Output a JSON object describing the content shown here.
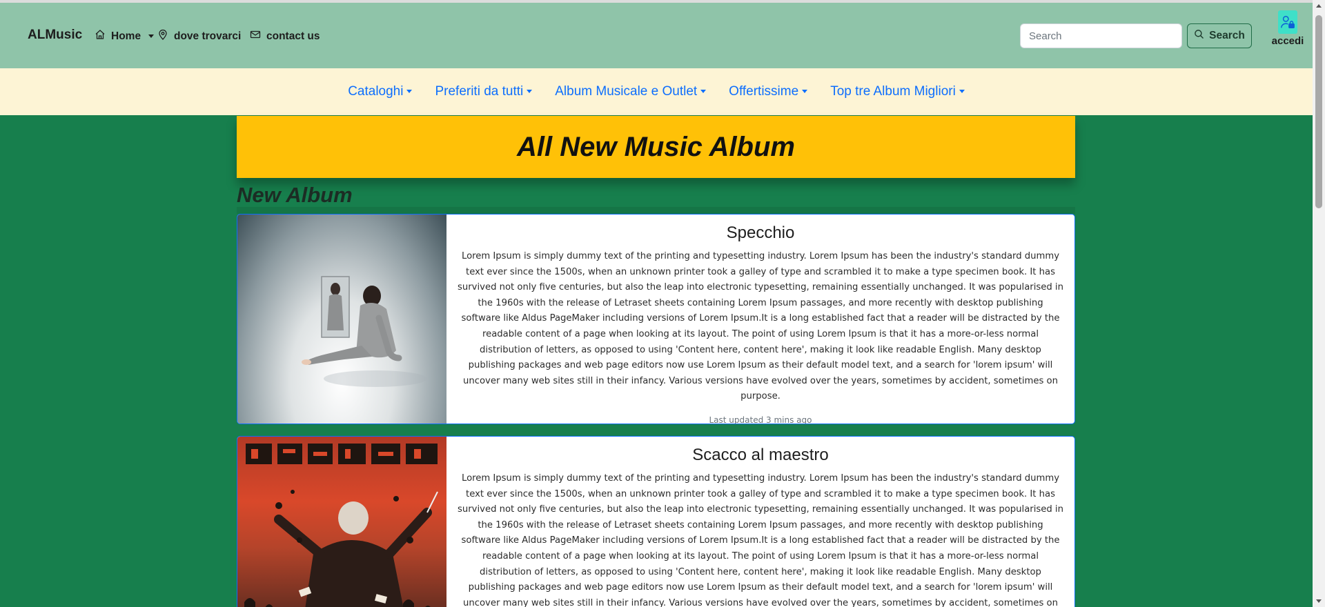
{
  "navbar": {
    "brand": "ALMusic",
    "home_label": "Home",
    "location_label": "dove trovarci",
    "contact_label": "contact us",
    "search_placeholder": "Search",
    "search_button": "Search",
    "login_label": "accedi"
  },
  "menu": {
    "items": [
      {
        "label": "Cataloghi"
      },
      {
        "label": "Preferiti da tutti"
      },
      {
        "label": "Album Musicale e Outlet"
      },
      {
        "label": "Offertissime"
      },
      {
        "label": "Top tre Album Migliori"
      }
    ]
  },
  "banner": {
    "title": "All New Music Album"
  },
  "section": {
    "title": "New Album"
  },
  "albums": [
    {
      "title": "Specchio",
      "description": "Lorem Ipsum is simply dummy text of the printing and typesetting industry. Lorem Ipsum has been the industry's standard dummy text ever since the 1500s, when an unknown printer took a galley of type and scrambled it to make a type specimen book. It has survived not only five centuries, but also the leap into electronic typesetting, remaining essentially unchanged. It was popularised in the 1960s with the release of Letraset sheets containing Lorem Ipsum passages, and more recently with desktop publishing software like Aldus PageMaker including versions of Lorem Ipsum.It is a long established fact that a reader will be distracted by the readable content of a page when looking at its layout. The point of using Lorem Ipsum is that it has a more-or-less normal distribution of letters, as opposed to using 'Content here, content here', making it look like readable English. Many desktop publishing packages and web page editors now use Lorem Ipsum as their default model text, and a search for 'lorem ipsum' will uncover many web sites still in their infancy. Various versions have evolved over the years, sometimes by accident, sometimes on purpose.",
      "updated": "Last updated 3 mins ago"
    },
    {
      "title": "Scacco al maestro",
      "description": "Lorem Ipsum is simply dummy text of the printing and typesetting industry. Lorem Ipsum has been the industry's standard dummy text ever since the 1500s, when an unknown printer took a galley of type and scrambled it to make a type specimen book. It has survived not only five centuries, but also the leap into electronic typesetting, remaining essentially unchanged. It was popularised in the 1960s with the release of Letraset sheets containing Lorem Ipsum passages, and more recently with desktop publishing software like Aldus PageMaker including versions of Lorem Ipsum.It is a long established fact that a reader will be distracted by the readable content of a page when looking at its layout. The point of using Lorem Ipsum is that it has a more-or-less normal distribution of letters, as opposed to using 'Content here, content here', making it look like readable English. Many desktop publishing packages and web page editors now use Lorem Ipsum as their default model text, and a search for 'lorem ipsum' will uncover many web sites still in their infancy. Various versions have evolved over the years, sometimes by accident, sometimes on purpose."
    }
  ],
  "colors": {
    "navbar_bg": "#8fc4a9",
    "menu_bg": "#fdf4d5",
    "page_bg": "#177f4d",
    "banner_bg": "#ffc107",
    "link": "#0d6efd"
  }
}
